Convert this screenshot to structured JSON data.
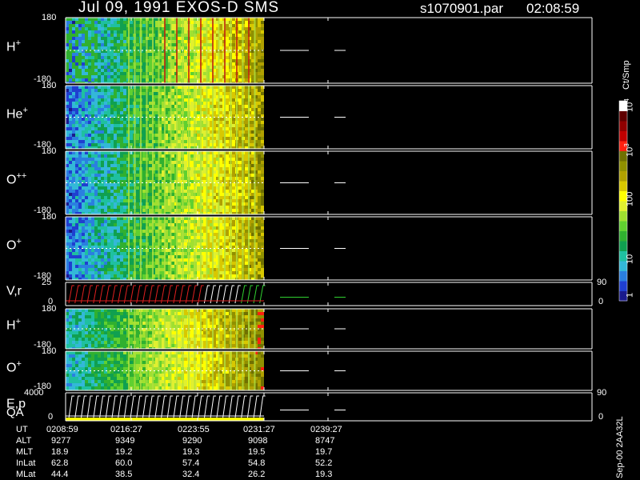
{
  "header": {
    "title": "Jul 09, 1991    EXOS-D SMS",
    "file": "s1070901.par",
    "time": "02:08:59"
  },
  "panels": [
    {
      "id": "H+",
      "ion": "H",
      "charge": "+",
      "ymax": "180",
      "ymin": "-180",
      "kind": "angle"
    },
    {
      "id": "He+",
      "ion": "He",
      "charge": "+",
      "ymax": "180",
      "ymin": "-180",
      "kind": "angle"
    },
    {
      "id": "O++",
      "ion": "O",
      "charge": "++",
      "ymax": "180",
      "ymin": "-180",
      "kind": "angle"
    },
    {
      "id": "O+",
      "ion": "O",
      "charge": "+",
      "ymax": "180",
      "ymin": "-180",
      "kind": "angle"
    },
    {
      "id": "Vr",
      "ion": "V,r",
      "charge": "",
      "ymax": "25",
      "ymin": "0",
      "kind": "vector",
      "right_top": "90",
      "right_bottom": "0"
    },
    {
      "id": "H+b",
      "ion": "H",
      "charge": "+",
      "ymax": "180",
      "ymin": "-180",
      "kind": "angle"
    },
    {
      "id": "O+b",
      "ion": "O",
      "charge": "+",
      "ymax": "180",
      "ymin": "-180",
      "kind": "angle"
    },
    {
      "id": "Ep",
      "ion": "E,p",
      "charge": "",
      "ymax": "4000",
      "ymin": "0",
      "kind": "vector",
      "right_top": "90",
      "right_bottom": "0",
      "extra_label": "QA"
    }
  ],
  "colorbar": {
    "unit": "Ct/Smp",
    "tick_labels": [
      "1",
      "10",
      "100",
      "10",
      "10"
    ],
    "tick_exponents": [
      "",
      "",
      "",
      "3",
      "4"
    ],
    "colors": [
      "#1a1a8c",
      "#1f3fd0",
      "#2a7fe0",
      "#33b8d8",
      "#1fc0a0",
      "#10a050",
      "#30b030",
      "#60d030",
      "#a0e030",
      "#e0f030",
      "#ffff00",
      "#d8c800",
      "#b0a000",
      "#909000",
      "#707000",
      "#ff2010",
      "#c00000",
      "#900000",
      "#600000",
      "#ffffff"
    ]
  },
  "chart_data": {
    "type": "heatmap",
    "title": "Jul 09, 1991    EXOS-D SMS",
    "x": [
      "0208:59",
      "0216:27",
      "0223:55",
      "0231:27",
      "0239:27"
    ],
    "ylim": [
      -180,
      180
    ]
  },
  "ephemeris": {
    "rows": [
      {
        "name": "UT",
        "values": [
          "0208:59",
          "0216:27",
          "0223:55",
          "0231:27",
          "0239:27"
        ]
      },
      {
        "name": "ALT",
        "values": [
          "9277",
          "9349",
          "9290",
          "9098",
          "8747"
        ]
      },
      {
        "name": "MLT",
        "values": [
          "18.9",
          "19.2",
          "19.3",
          "19.5",
          "19.7"
        ]
      },
      {
        "name": "InLat",
        "values": [
          "62.8",
          "60.0",
          "57.4",
          "54.8",
          "52.2"
        ]
      },
      {
        "name": "MLat",
        "values": [
          "44.4",
          "38.5",
          "32.4",
          "26.2",
          "19.3"
        ]
      }
    ]
  },
  "credit": "Sep-00  2AA32L"
}
